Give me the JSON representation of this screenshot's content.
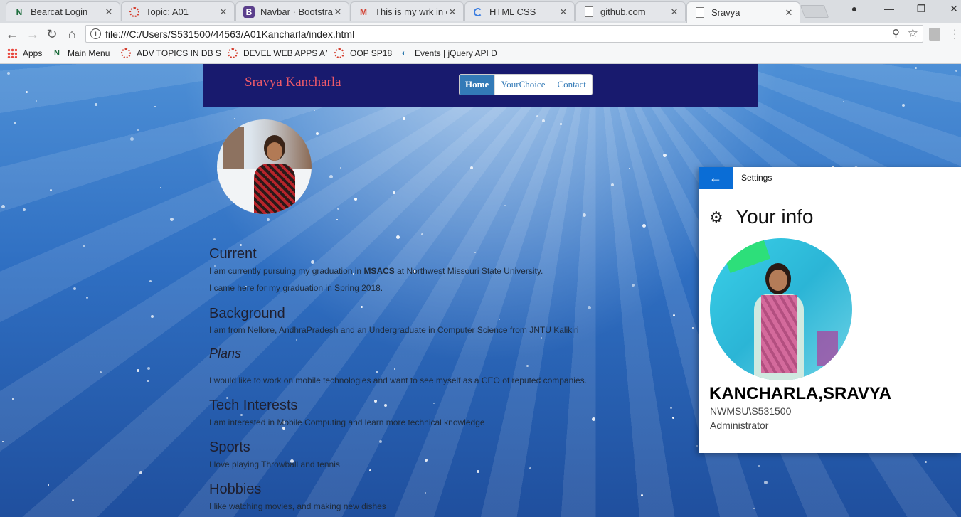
{
  "browser": {
    "tabs": [
      {
        "title": "Bearcat Login",
        "icon": "n-logo-icon"
      },
      {
        "title": "Topic: A01",
        "icon": "loading-ring-icon"
      },
      {
        "title": "Navbar · Bootstrap",
        "icon": "bootstrap-icon"
      },
      {
        "title": "This is my wrk in c",
        "icon": "gmail-icon"
      },
      {
        "title": "HTML CSS",
        "icon": "loading-spinner-icon"
      },
      {
        "title": "github.com",
        "icon": "page-icon"
      },
      {
        "title": "Sravya",
        "icon": "page-icon"
      }
    ],
    "active_tab_index": 6,
    "url": "file:///C:/Users/S531500/44563/A01Kancharla/index.html",
    "bookmarks": [
      {
        "label": "Apps",
        "icon": "apps-grid-icon"
      },
      {
        "label": "Main Menu",
        "icon": "n-logo-icon"
      },
      {
        "label": "ADV TOPICS IN DB S ",
        "icon": "ring-icon"
      },
      {
        "label": "DEVEL WEB APPS AN",
        "icon": "ring-icon"
      },
      {
        "label": "OOP SP18",
        "icon": "ring-icon"
      },
      {
        "label": "Events | jQuery API D",
        "icon": "jquery-icon"
      }
    ]
  },
  "site": {
    "brand": "Sravya Kancharla",
    "nav": [
      "Home",
      "YourChoice",
      "Contact"
    ],
    "sections": [
      {
        "heading": "Current",
        "italic": false,
        "lines": [
          {
            "before": "I am currently pursuing my graduation in ",
            "bold": "MSACS",
            "after": " at Northwest Missouri State University."
          },
          {
            "before": "I came here for my graduation in Spring 2018.",
            "bold": "",
            "after": ""
          }
        ]
      },
      {
        "heading": "Background",
        "italic": false,
        "lines": [
          {
            "before": "I am from Nellore, AndhraPradesh and an Undergraduate in Computer Science from JNTU Kalikiri",
            "bold": "",
            "after": ""
          }
        ]
      },
      {
        "heading": "Plans",
        "italic": true,
        "lines": [
          {
            "before": "I would like to work on mobile technologies and want to see myself as a CEO of reputed companies.",
            "bold": "",
            "after": ""
          }
        ]
      },
      {
        "heading": "Tech Interests",
        "italic": false,
        "lines": [
          {
            "before": "I am interested in Mobile Computing and learn more technical knowledge",
            "bold": "",
            "after": ""
          }
        ]
      },
      {
        "heading": "Sports",
        "italic": false,
        "lines": [
          {
            "before": "I love playing Throwball and tennis",
            "bold": "",
            "after": ""
          }
        ]
      },
      {
        "heading": "Hobbies",
        "italic": false,
        "lines": [
          {
            "before": "I like watching movies, and making new dishes",
            "bold": "",
            "after": ""
          }
        ]
      }
    ]
  },
  "settings": {
    "window_title": "Settings",
    "page_title": "Your info",
    "name": "KANCHARLA,SRAVYA",
    "account": "NWMSU\\S531500",
    "role": "Administrator",
    "accent_color": "#0a6dd6"
  }
}
